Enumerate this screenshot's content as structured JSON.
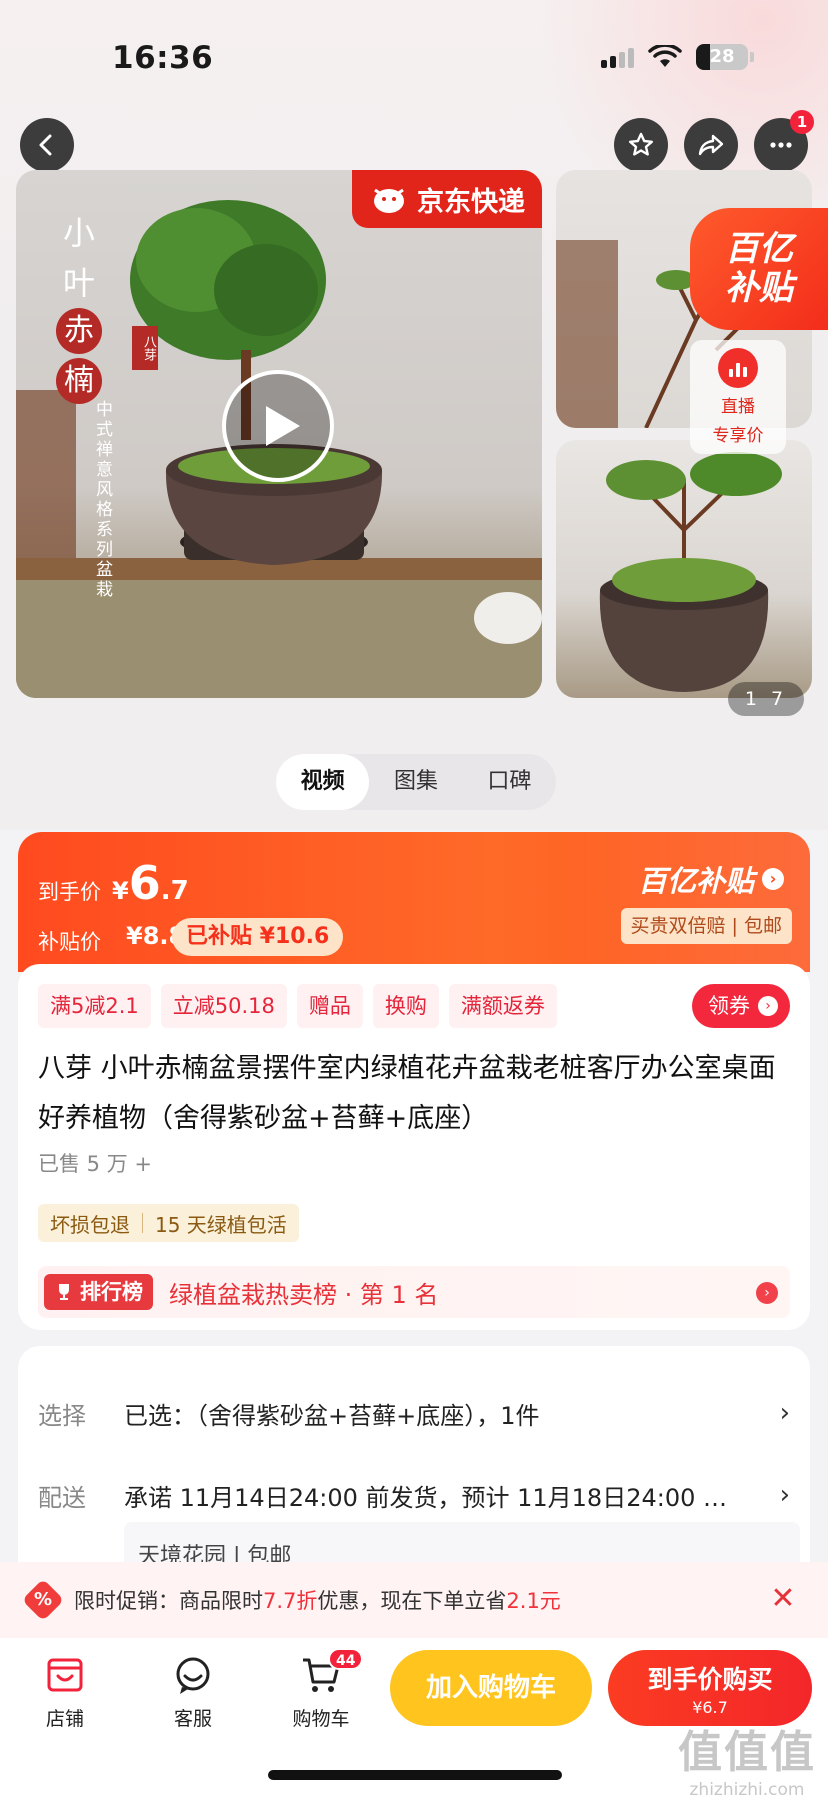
{
  "status": {
    "time": "16:36",
    "battery": "28"
  },
  "nav": {
    "notify_count": "1"
  },
  "gallery": {
    "jd_badge": "京东快递",
    "main_vertical_title": [
      "小",
      "叶",
      "赤",
      "楠"
    ],
    "main_vertical_sub": "中式禅意风格系列盆栽",
    "brand_mark": "八芽",
    "page_current": "1",
    "page_total": "7",
    "billion_badge_line1": "百亿",
    "billion_badge_line2": "补贴",
    "live_line1": "直播",
    "live_line2": "专享价"
  },
  "media_tabs": [
    "视频",
    "图集",
    "口碑"
  ],
  "price": {
    "final_label": "到手价",
    "yen": "¥",
    "final_int": "6",
    "final_dec": ".7",
    "subsidy_label": "补贴价",
    "subsidy_price": "¥8.8",
    "subsidized": "已补贴 ¥10.6",
    "brand": "百亿补贴",
    "guarantee": "买贵双倍赔 | 包邮"
  },
  "coupons": [
    "满5减2.1",
    "立减50.18",
    "赠品",
    "换购",
    "满额返券"
  ],
  "get_coupon": "领券",
  "product": {
    "title": "八芽 小叶赤楠盆景摆件室内绿植花卉盆栽老桩客厅办公室桌面好养植物（舍得紫砂盆+苔藓+底座）",
    "sold": "已售 5 万 +",
    "guarantees": [
      "坏损包退",
      "15 天绿植包活"
    ],
    "rank_badge": "排行榜",
    "rank_text": "绿植盆栽热卖榜 · 第 1 名"
  },
  "select": {
    "select_label": "选择",
    "select_value": "已选：（舍得紫砂盆+苔藓+底座），1件",
    "delivery_label": "配送",
    "delivery_value": "承诺 11月14日24:00 前发货，预计 11月18日24:00 …",
    "store_text": "天境花园 | 包邮"
  },
  "promo": {
    "icon": "%",
    "prefix": "限时促销：商品限时",
    "discount": "7.7折",
    "middle": "优惠，现在下单立省",
    "save": "2.1元"
  },
  "bottom": {
    "store": "店铺",
    "service": "客服",
    "cart": "购物车",
    "cart_count": "44",
    "add_cart": "加入购物车",
    "buy_title": "到手价购买",
    "buy_price": "¥6.7"
  },
  "watermark": {
    "line1": "值值值",
    "line2": "zhizhizhi.com"
  },
  "colors": {
    "accent": "#ff4a1f",
    "red": "#f3283c",
    "yellow": "#ffc51e"
  }
}
